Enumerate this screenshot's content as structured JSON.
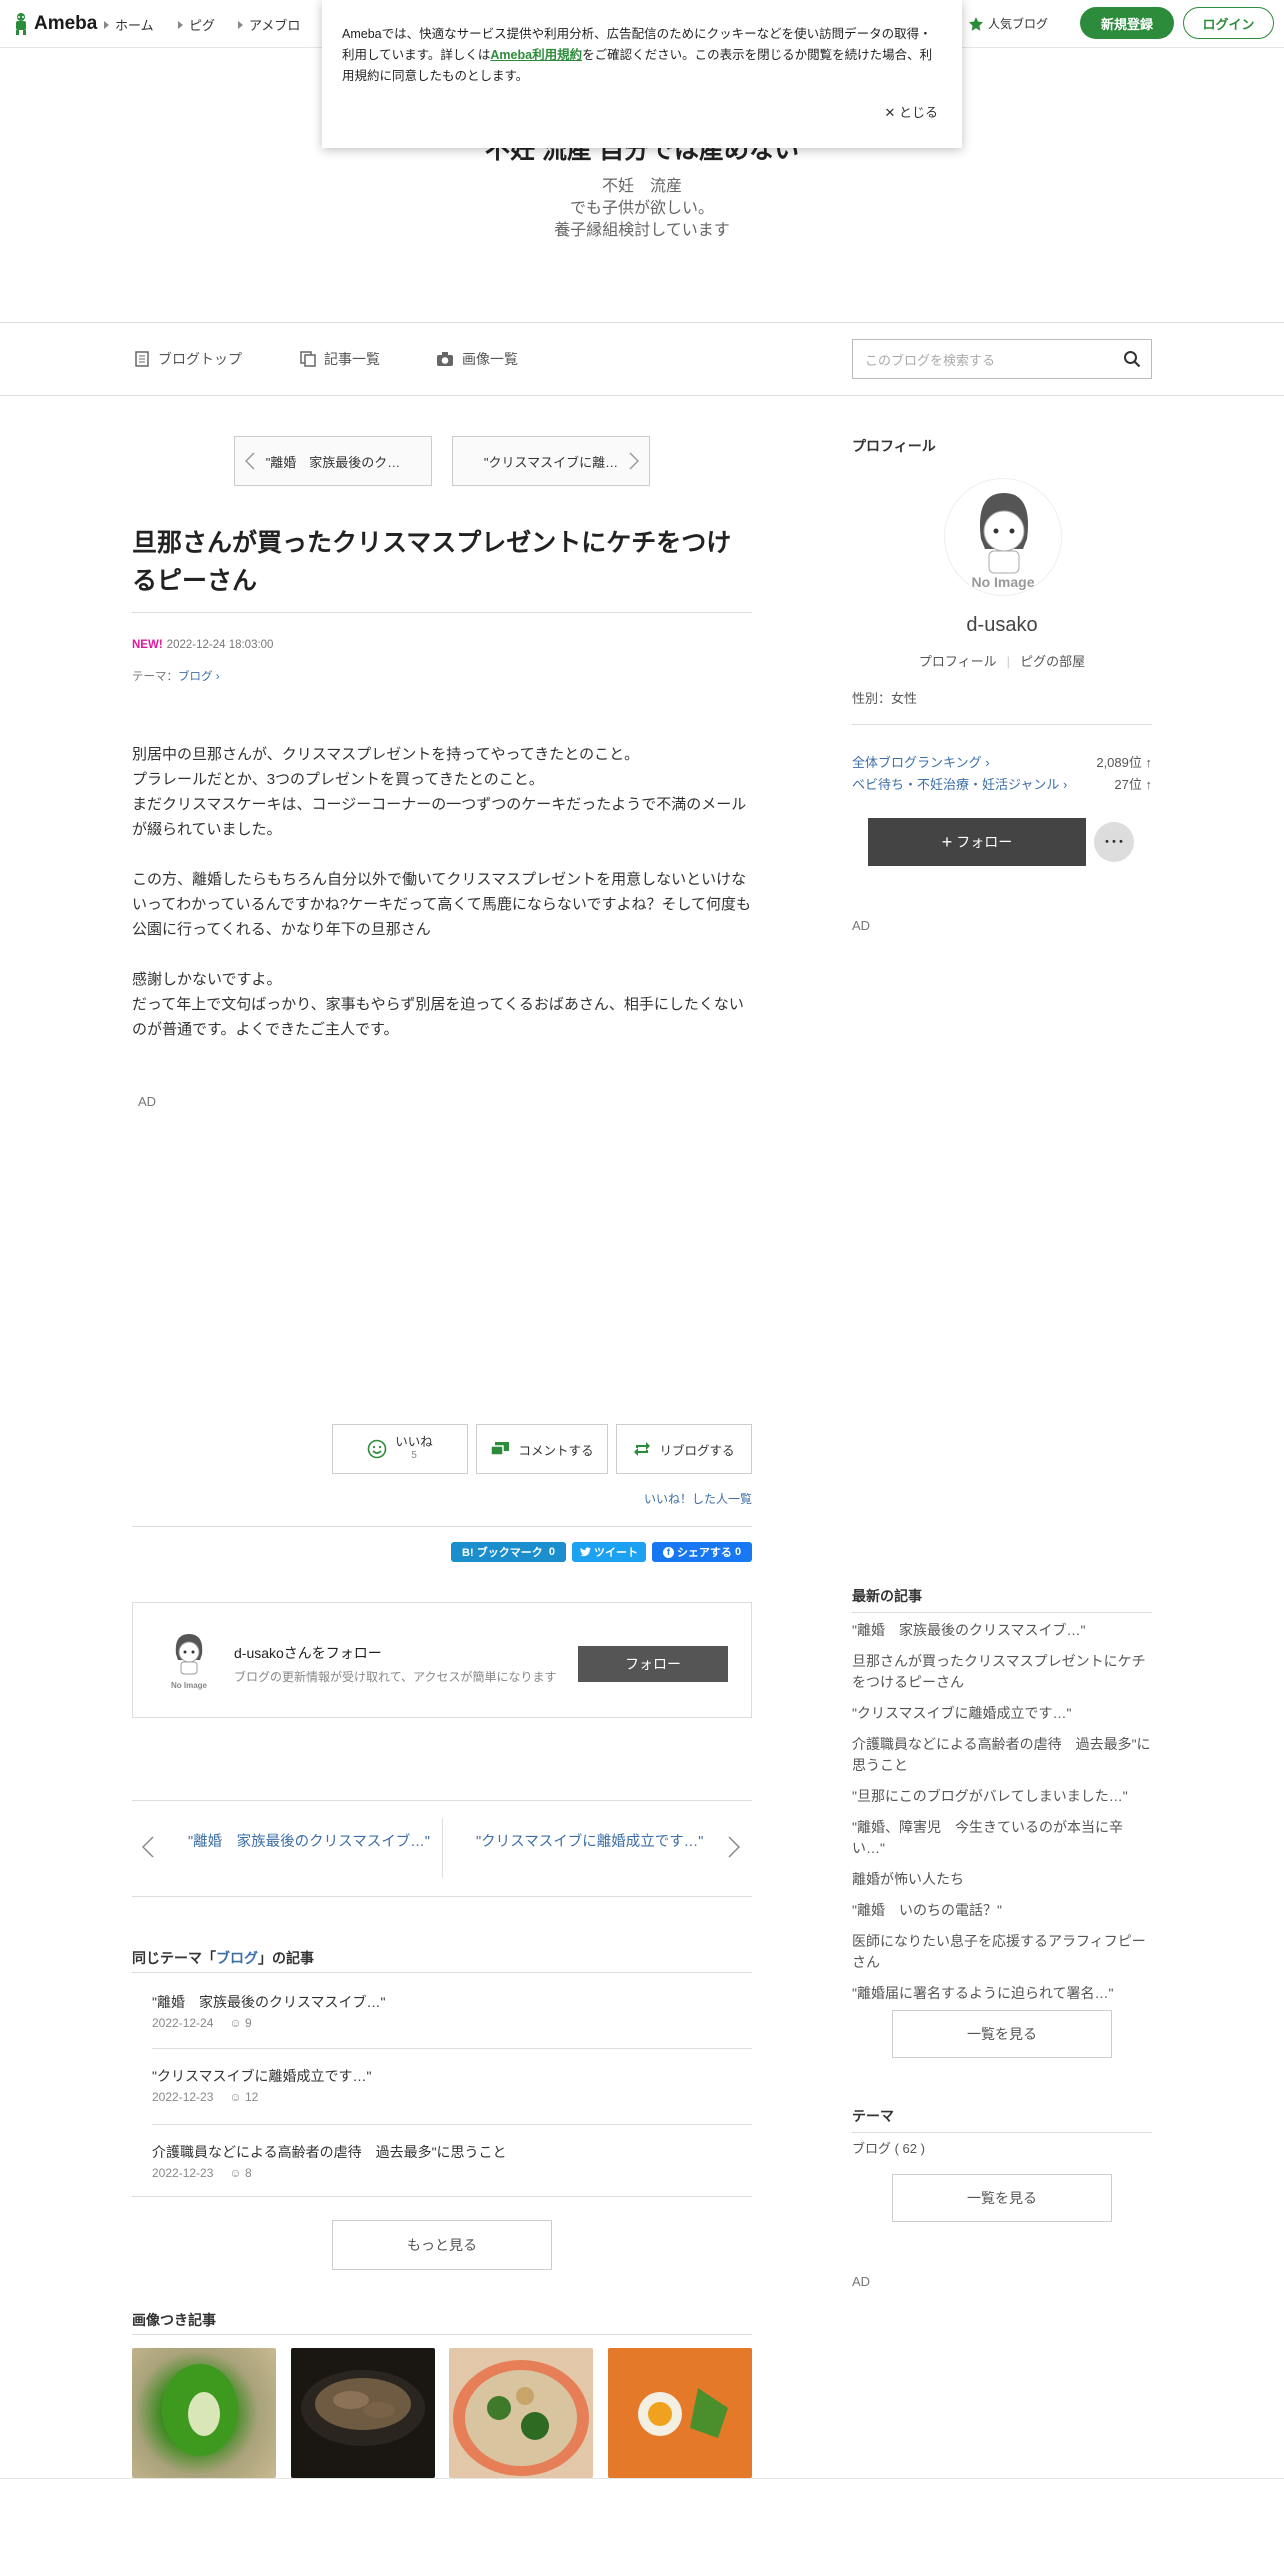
{
  "header": {
    "logo": "Ameba",
    "nav": [
      "ホーム",
      "ピグ",
      "アメブロ"
    ],
    "popular": "人気ブログ",
    "register": "新規登録",
    "login": "ログイン"
  },
  "cookie": {
    "text1": "Amebaでは、快適なサービス提供や利用分析、広告配信のためにクッキーなどを使い訪問データの取得・利用しています。詳しくは",
    "link": "Ameba利用規約",
    "text2": "をご確認ください。この表示を閉じるか閲覧を続けた場合、利用規約に同意したものとします。",
    "close": "とじる"
  },
  "blog": {
    "title": "不妊 流産 自分では産めない",
    "desc1": "不妊　流産",
    "desc2": "でも子供が欲しい。",
    "desc3": "養子縁組検討しています"
  },
  "subnav": {
    "top": "ブログトップ",
    "list": "記事一覧",
    "images": "画像一覧",
    "search_placeholder": "このブログを検索する"
  },
  "pager_top": {
    "prev": "\"離婚　家族最後のク…",
    "next": "\"クリスマスイブに離…"
  },
  "article": {
    "title": "旦那さんが買ったクリスマスプレゼントにケチをつけるピーさん",
    "new": "NEW!",
    "date": "2022-12-24 18:03:00",
    "theme_label": "テーマ：",
    "theme": "ブログ",
    "p1a": "別居中の旦那さんが、クリスマスプレゼントを持ってやってきたとのこと。",
    "p1b": "プラレールだとか、3つのプレゼントを買ってきたとのこと。",
    "p1c": "まだクリスマスケーキは、コージーコーナーの一つずつのケーキだったようで不満のメールが綴られていました。",
    "p2": "この方、離婚したらもちろん自分以外で働いてクリスマスプレゼントを用意しないといけないってわかっているんですかね?ケーキだって高くて馬鹿にならないですよね？そして何度も公園に行ってくれる、かなり年下の旦那さん",
    "p3a": "感謝しかないですよ。",
    "p3b": "だって年上で文句ばっかり、家事もやらず別居を迫ってくるおばあさん、相手にしたくないのが普通です。よくできたご主人です。",
    "ad": "AD"
  },
  "actions": {
    "like": "いいね",
    "like_count": "5",
    "comment": "コメントする",
    "reblog": "リブログする",
    "likers": "いいね！した人一覧"
  },
  "share": {
    "bookmark": "B! ブックマーク",
    "bookmark_count": "0",
    "tweet": "ツイート",
    "fb": "シェアする",
    "fb_count": "0"
  },
  "followbox": {
    "name": "d-usakoさんをフォロー",
    "desc": "ブログの更新情報が受け取れて、アクセスが簡単になります",
    "button": "フォロー",
    "noimage": "No Image"
  },
  "pager_bottom": {
    "prev": "\"離婚　家族最後のクリスマスイブ…\"",
    "next": "\"クリスマスイブに離婚成立です…\""
  },
  "same_theme": {
    "heading_pre": "同じテーマ「",
    "heading_theme": "ブログ",
    "heading_post": "」の記事",
    "items": [
      {
        "title": "\"離婚　家族最後のクリスマスイブ…\"",
        "date": "2022-12-24",
        "likes": "9"
      },
      {
        "title": "\"クリスマスイブに離婚成立です…\"",
        "date": "2022-12-23",
        "likes": "12"
      },
      {
        "title": "介護職員などによる高齢者の虐待　過去最多\"に思うこと",
        "date": "2022-12-23",
        "likes": "8"
      }
    ],
    "more": "もっと見る"
  },
  "images_section": {
    "heading": "画像つき記事"
  },
  "sidebar": {
    "profile_h": "プロフィール",
    "noimage": "No Image",
    "name": "d-usako",
    "profile_link": "プロフィール",
    "pig_link": "ピグの部屋",
    "gender": "性別：女性",
    "rank1_label": "全体ブログランキング",
    "rank1_val": "2,089位 ↑",
    "rank2_label": "ベビ待ち・不妊治療・妊活ジャンル",
    "rank2_val": "27位 ↑",
    "follow": "フォロー",
    "dots": "･･･",
    "ad": "AD",
    "recent_h": "最新の記事",
    "recent": [
      "\"離婚　家族最後のクリスマスイブ…\"",
      "旦那さんが買ったクリスマスプレゼントにケチをつけるピーさん",
      "\"クリスマスイブに離婚成立です…\"",
      "介護職員などによる高齢者の虐待　過去最多\"に思うこと",
      "\"旦那にこのブログがバレてしまいました…\"",
      "\"離婚、障害児　今生きているのが本当に辛い…\"",
      "離婚が怖い人たち",
      "\"離婚　いのちの電話？\"",
      "医師になりたい息子を応援するアラフィフピーさん",
      "\"離婚届に署名するように迫られて署名…\""
    ],
    "see_list": "一覧を見る",
    "theme_h": "テーマ",
    "theme_item": "ブログ ( 62 )",
    "see_list2": "一覧を見る",
    "ad2": "AD"
  },
  "colors": {
    "brand": "#2d8c3c",
    "link": "#3d6fa7",
    "new": "#e0199c",
    "twitter": "#1da1f2",
    "hatena": "#1b8fce",
    "facebook": "#1877f2"
  }
}
